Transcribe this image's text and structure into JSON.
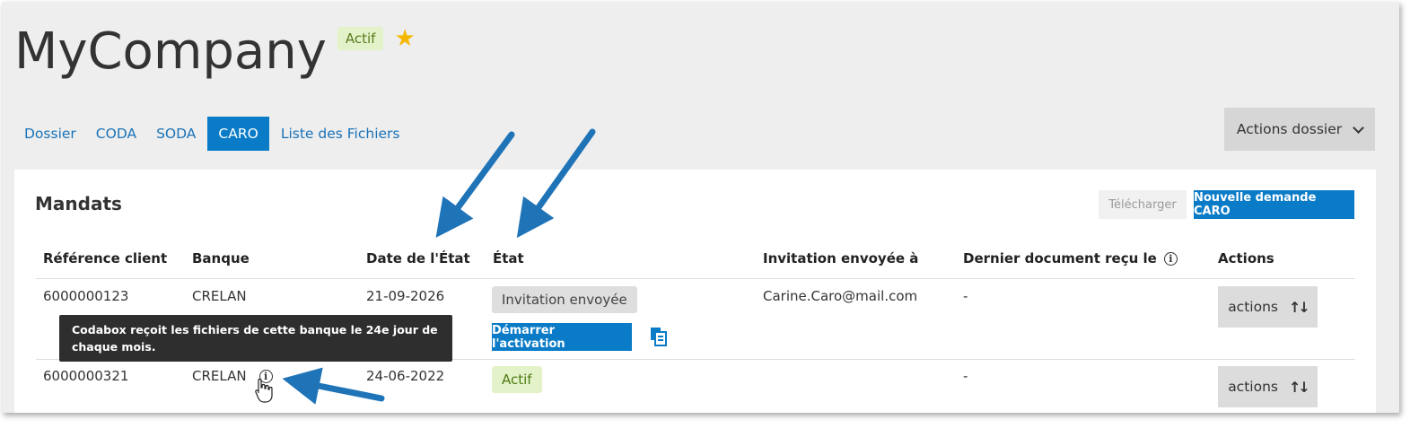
{
  "company": {
    "name": "MyCompany",
    "status_badge": "Actif",
    "star_icon": "star-icon"
  },
  "tabs": [
    {
      "label": "Dossier",
      "active": false
    },
    {
      "label": "CODA",
      "active": false
    },
    {
      "label": "SODA",
      "active": false
    },
    {
      "label": "CARO",
      "active": true
    },
    {
      "label": "Liste des Fichiers",
      "active": false
    }
  ],
  "dossier_actions": {
    "label": "Actions dossier"
  },
  "mandates": {
    "title": "Mandats",
    "download_label": "Télécharger",
    "new_request_label": "Nouvelle demande CARO",
    "columns": [
      "Référence client",
      "Banque",
      "Date de l'État",
      "État",
      "Invitation envoyée à",
      "Dernier document reçu le",
      "Actions"
    ],
    "rows": [
      {
        "reference": "6000000123",
        "bank": "CRELAN",
        "state_date": "21-09-2026",
        "state": "Invitation envoyée",
        "invitation_to": "Carine.Caro@mail.com",
        "last_document": "-",
        "activate_label": "Démarrer l'activation",
        "actions_label": "actions"
      },
      {
        "reference": "6000000321",
        "bank": "CRELAN",
        "state_date": "24-06-2022",
        "state": "Actif",
        "invitation_to": "",
        "last_document": "-",
        "actions_label": "actions"
      }
    ]
  },
  "tooltip": {
    "text": "Codabox reçoit les fichiers de cette banque le 24e jour de chaque mois."
  },
  "colors": {
    "primary": "#0a7bc7",
    "link": "#1a73b8",
    "active_badge_bg": "#e3f2c8",
    "annotation_arrow": "#1f73b7"
  }
}
